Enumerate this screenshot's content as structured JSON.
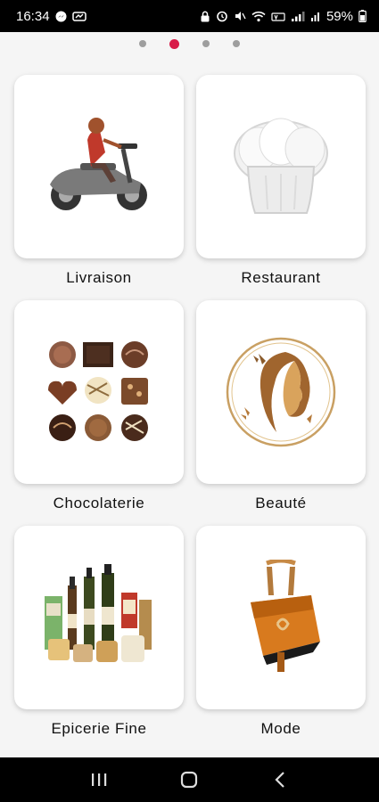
{
  "status": {
    "time": "16:34",
    "battery": "59%"
  },
  "pager": {
    "count": 4,
    "active_index": 1
  },
  "categories": [
    {
      "label": "Livraison",
      "icon": "scooter-delivery-icon"
    },
    {
      "label": "Restaurant",
      "icon": "chef-hat-icon"
    },
    {
      "label": "Chocolaterie",
      "icon": "chocolates-icon"
    },
    {
      "label": "Beauté",
      "icon": "beauty-woman-icon"
    },
    {
      "label": "Epicerie Fine",
      "icon": "grocery-products-icon"
    },
    {
      "label": "Mode",
      "icon": "handbag-icon"
    }
  ],
  "colors": {
    "accent": "#d81b48",
    "background": "#f5f5f5"
  }
}
